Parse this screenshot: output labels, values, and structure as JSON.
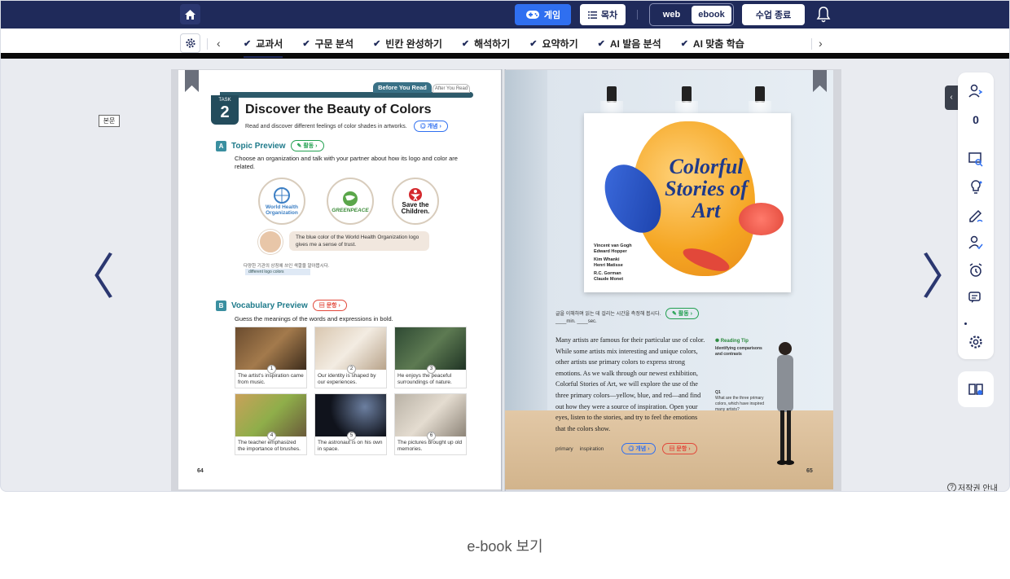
{
  "topbar": {
    "game_label": "게임",
    "toc_label": "목차",
    "view_web": "web",
    "view_ebook": "ebook",
    "end_class_label": "수업 종료"
  },
  "tabs": [
    {
      "label": "교과서",
      "active": true
    },
    {
      "label": "구문 분석"
    },
    {
      "label": "빈칸 완성하기"
    },
    {
      "label": "해석하기"
    },
    {
      "label": "요약하기"
    },
    {
      "label": "AI 발음 분석"
    },
    {
      "label": "AI 맞춤 학습"
    }
  ],
  "bonmun_label": "본문",
  "copyright_label": "저작권 안내",
  "caption": "e-book 보기",
  "sidebar": {
    "count": "0"
  },
  "left_page": {
    "tab_before": "Before You Read",
    "tab_after": "After You Read",
    "task_label": "TASK",
    "task_num": "2",
    "title": "Discover the Beauty of Colors",
    "subtitle": "Read and discover different feelings of color shades in artworks.",
    "concept_pill": "개념",
    "section_a_letter": "A",
    "section_a_title": "Topic Preview",
    "activity_pill": "활동",
    "section_a_desc": "Choose an organization and talk with your partner about how its logo and color are related.",
    "logos": [
      "World Health Organization",
      "GREENPEACE",
      "Save the Children."
    ],
    "speech": "The blue color of the World Health Organization logo gives me a sense of trust.",
    "note_small": "다양한 기관의 상징에 쓰인 색깔을 알아봅시다.",
    "note_bar": "different logo colors",
    "section_b_letter": "B",
    "section_b_title": "Vocabulary Preview",
    "question_pill": "문항",
    "section_b_desc": "Guess the meanings of the words and expressions in bold.",
    "vocab": [
      {
        "n": "1",
        "text": "The artist's inspiration came from music."
      },
      {
        "n": "2",
        "text": "Our identity is shaped by our experiences."
      },
      {
        "n": "3",
        "text": "He enjoys the peaceful surroundings of nature."
      },
      {
        "n": "4",
        "text": "The teacher emphasized the importance of brushes."
      },
      {
        "n": "5",
        "text": "The astronaut is on his own in space."
      },
      {
        "n": "6",
        "text": "The pictures brought up old memories."
      }
    ],
    "page_number": "64"
  },
  "right_page": {
    "poster_title": "Colorful Stories of Art",
    "poster_names": [
      "Vincent van Gogh",
      "Edward Hopper",
      "Kim Whanki",
      "Henri Matisse",
      "R.C. Gorman",
      "Claude Monet"
    ],
    "read_line": "글을 이해하며 읽는 데 걸리는 시간을 측정해 봅시다.",
    "read_min": "____min. ____sec.",
    "activity_pill": "활동",
    "body": "Many artists are famous for their particular use of color. While some artists mix interesting and unique colors, other artists use primary colors to express strong emotions. As we walk through our newest exhibition, Colorful Stories of Art, we will explore the use of the three primary colors—yellow, blue, and red—and find out how they were a source of inspiration. Open your eyes, listen to the stories, and try to feel the emotions that the colors show.",
    "tip_title": "Reading Tip",
    "tip_sub": "Identifying comparisons and contrasts",
    "q1_label": "Q1",
    "q1_text": "What are the three primary colors, which have inspired many artists?",
    "foot_word1": "primary",
    "foot_word2": "inspiration",
    "concept_pill": "개념",
    "question_pill": "문항",
    "page_number": "65"
  }
}
